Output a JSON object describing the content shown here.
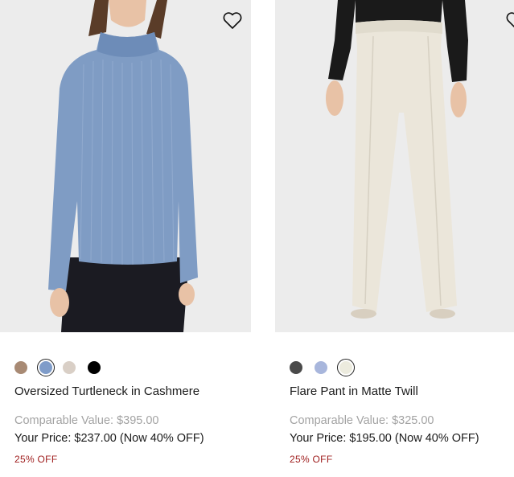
{
  "products": [
    {
      "name": "Oversized Turtleneck in Cashmere",
      "comparable_value": "Comparable Value: $395.00",
      "your_price": "Your Price: $237.00 (Now 40% OFF)",
      "discount_badge": "25% OFF",
      "image_icon": "heart-icon",
      "swatches": [
        {
          "color": "#a88a74",
          "selected": false
        },
        {
          "color": "#7f9cc9",
          "selected": true
        },
        {
          "color": "#d9cfc6",
          "selected": false
        },
        {
          "color": "#000000",
          "selected": false
        }
      ]
    },
    {
      "name": "Flare Pant in Matte Twill",
      "comparable_value": "Comparable Value: $325.00",
      "your_price": "Your Price: $195.00 (Now 40% OFF)",
      "discount_badge": "25% OFF",
      "image_icon": "heart-icon",
      "swatches": [
        {
          "color": "#4a4a4a",
          "selected": false
        },
        {
          "color": "#a8b6dc",
          "selected": false
        },
        {
          "color": "#ecebde",
          "selected": true
        }
      ]
    }
  ],
  "colors": {
    "price_text": "#1a1a1a",
    "comparable_text": "#a3a3a3",
    "discount_text": "#a02020",
    "image_background": "#ececec"
  }
}
